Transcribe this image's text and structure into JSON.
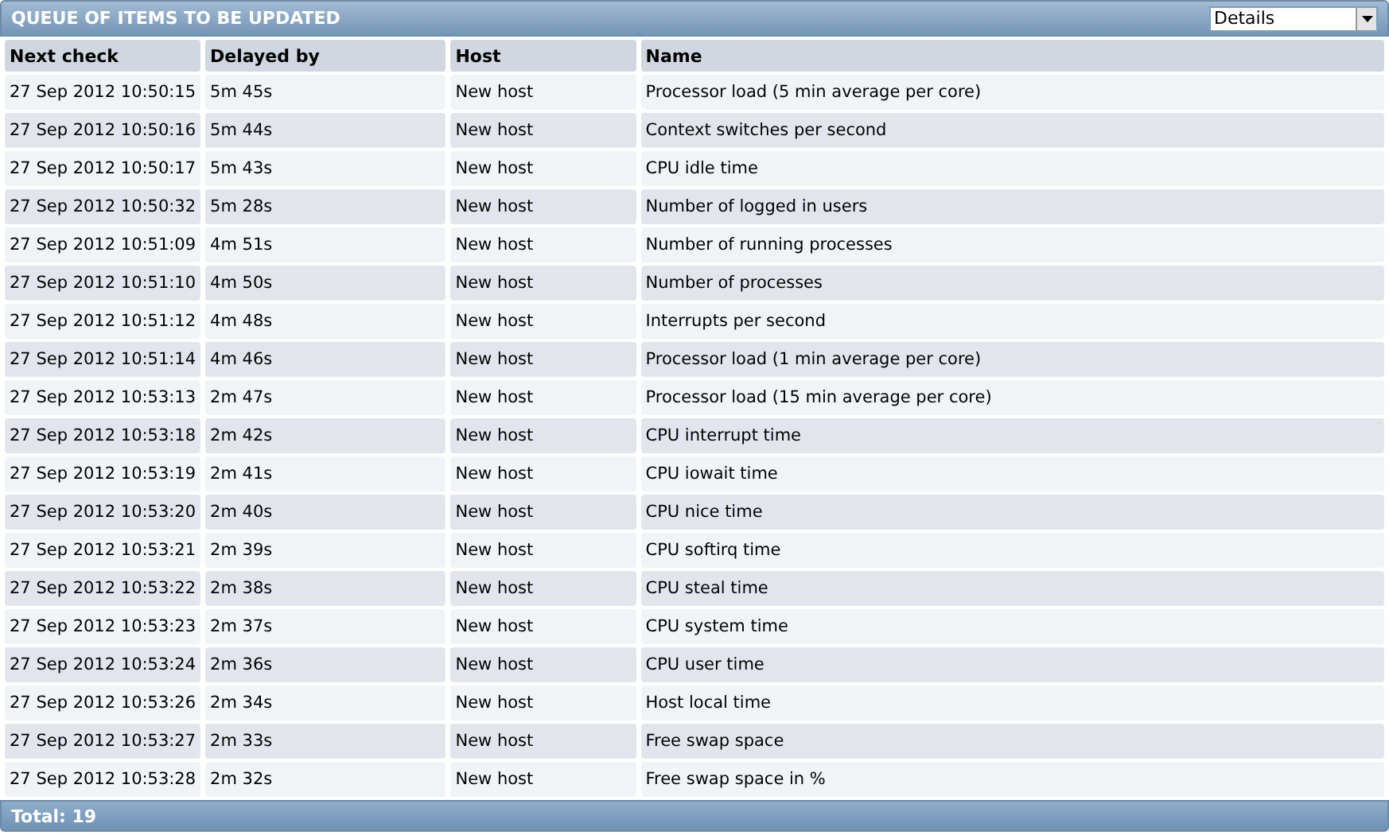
{
  "title": "QUEUE OF ITEMS TO BE UPDATED",
  "view_select": {
    "value": "Details"
  },
  "table": {
    "columns": [
      "Next check",
      "Delayed by",
      "Host",
      "Name"
    ],
    "rows": [
      [
        "27 Sep 2012 10:50:15",
        "5m 45s",
        "New host",
        "Processor load (5 min average per core)"
      ],
      [
        "27 Sep 2012 10:50:16",
        "5m 44s",
        "New host",
        "Context switches per second"
      ],
      [
        "27 Sep 2012 10:50:17",
        "5m 43s",
        "New host",
        "CPU idle time"
      ],
      [
        "27 Sep 2012 10:50:32",
        "5m 28s",
        "New host",
        "Number of logged in users"
      ],
      [
        "27 Sep 2012 10:51:09",
        "4m 51s",
        "New host",
        "Number of running processes"
      ],
      [
        "27 Sep 2012 10:51:10",
        "4m 50s",
        "New host",
        "Number of processes"
      ],
      [
        "27 Sep 2012 10:51:12",
        "4m 48s",
        "New host",
        "Interrupts per second"
      ],
      [
        "27 Sep 2012 10:51:14",
        "4m 46s",
        "New host",
        "Processor load (1 min average per core)"
      ],
      [
        "27 Sep 2012 10:53:13",
        "2m 47s",
        "New host",
        "Processor load (15 min average per core)"
      ],
      [
        "27 Sep 2012 10:53:18",
        "2m 42s",
        "New host",
        "CPU interrupt time"
      ],
      [
        "27 Sep 2012 10:53:19",
        "2m 41s",
        "New host",
        "CPU iowait time"
      ],
      [
        "27 Sep 2012 10:53:20",
        "2m 40s",
        "New host",
        "CPU nice time"
      ],
      [
        "27 Sep 2012 10:53:21",
        "2m 39s",
        "New host",
        "CPU softirq time"
      ],
      [
        "27 Sep 2012 10:53:22",
        "2m 38s",
        "New host",
        "CPU steal time"
      ],
      [
        "27 Sep 2012 10:53:23",
        "2m 37s",
        "New host",
        "CPU system time"
      ],
      [
        "27 Sep 2012 10:53:24",
        "2m 36s",
        "New host",
        "CPU user time"
      ],
      [
        "27 Sep 2012 10:53:26",
        "2m 34s",
        "New host",
        "Host local time"
      ],
      [
        "27 Sep 2012 10:53:27",
        "2m 33s",
        "New host",
        "Free swap space"
      ],
      [
        "27 Sep 2012 10:53:28",
        "2m 32s",
        "New host",
        "Free swap space in %"
      ]
    ]
  },
  "footer": "Total: 19"
}
